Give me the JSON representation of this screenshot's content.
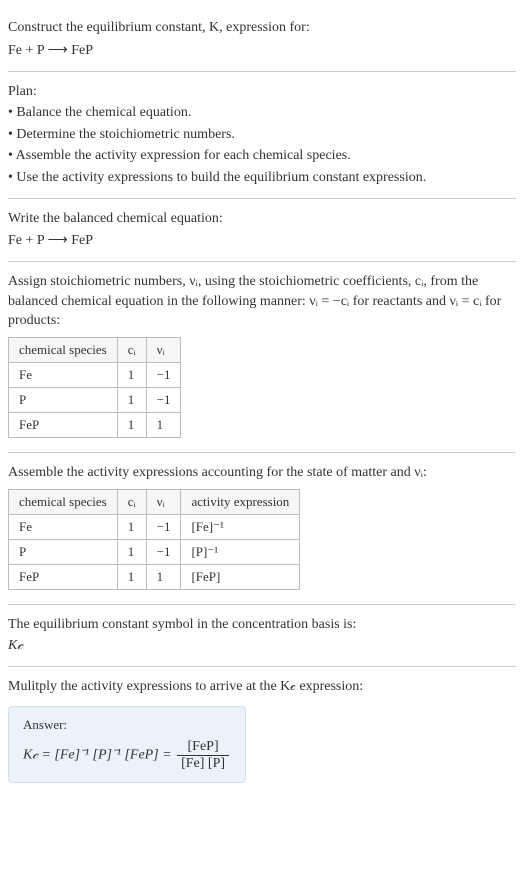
{
  "prompt": {
    "line1": "Construct the equilibrium constant, K, expression for:",
    "equation": "Fe + P ⟶ FeP"
  },
  "plan": {
    "heading": "Plan:",
    "bullets": [
      "• Balance the chemical equation.",
      "• Determine the stoichiometric numbers.",
      "• Assemble the activity expression for each chemical species.",
      "• Use the activity expressions to build the equilibrium constant expression."
    ]
  },
  "balanced": {
    "heading": "Write the balanced chemical equation:",
    "equation": "Fe + P ⟶ FeP"
  },
  "stoich": {
    "intro": "Assign stoichiometric numbers, νᵢ, using the stoichiometric coefficients, cᵢ, from the balanced chemical equation in the following manner: νᵢ = −cᵢ for reactants and νᵢ = cᵢ for products:",
    "headers": {
      "species": "chemical species",
      "ci": "cᵢ",
      "vi": "νᵢ"
    },
    "rows": [
      {
        "species": "Fe",
        "ci": "1",
        "vi": "−1"
      },
      {
        "species": "P",
        "ci": "1",
        "vi": "−1"
      },
      {
        "species": "FeP",
        "ci": "1",
        "vi": "1"
      }
    ]
  },
  "activity": {
    "intro": "Assemble the activity expressions accounting for the state of matter and νᵢ:",
    "headers": {
      "species": "chemical species",
      "ci": "cᵢ",
      "vi": "νᵢ",
      "expr": "activity expression"
    },
    "rows": [
      {
        "species": "Fe",
        "ci": "1",
        "vi": "−1",
        "expr": "[Fe]⁻¹"
      },
      {
        "species": "P",
        "ci": "1",
        "vi": "−1",
        "expr": "[P]⁻¹"
      },
      {
        "species": "FeP",
        "ci": "1",
        "vi": "1",
        "expr": "[FeP]"
      }
    ]
  },
  "symbol": {
    "intro": "The equilibrium constant symbol in the concentration basis is:",
    "value": "K𝒸"
  },
  "multiply_intro": "Mulitply the activity expressions to arrive at the K𝒸 expression:",
  "answer": {
    "label": "Answer:",
    "lhs": "K𝒸 = [Fe]⁻¹ [P]⁻¹ [FeP] =",
    "frac_top": "[FeP]",
    "frac_bot": "[Fe] [P]"
  }
}
